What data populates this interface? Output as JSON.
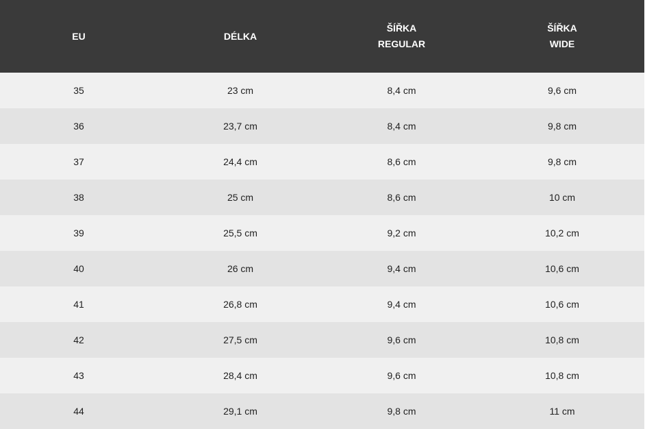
{
  "table": {
    "headers": [
      {
        "lines": [
          "EU"
        ]
      },
      {
        "lines": [
          "DÉLKA"
        ]
      },
      {
        "lines": [
          "ŠÍŘKA",
          "REGULAR"
        ]
      },
      {
        "lines": [
          "ŠÍŘKA",
          "WIDE"
        ]
      }
    ],
    "rows": [
      [
        "35",
        "23 cm",
        "8,4 cm",
        "9,6 cm"
      ],
      [
        "36",
        "23,7 cm",
        "8,4 cm",
        "9,8 cm"
      ],
      [
        "37",
        "24,4 cm",
        "8,6 cm",
        "9,8 cm"
      ],
      [
        "38",
        "25 cm",
        "8,6 cm",
        "10 cm"
      ],
      [
        "39",
        "25,5 cm",
        "9,2 cm",
        "10,2 cm"
      ],
      [
        "40",
        "26 cm",
        "9,4 cm",
        "10,6 cm"
      ],
      [
        "41",
        "26,8 cm",
        "9,4 cm",
        "10,6 cm"
      ],
      [
        "42",
        "27,5 cm",
        "9,6 cm",
        "10,8 cm"
      ],
      [
        "43",
        "28,4 cm",
        "9,6 cm",
        "10,8 cm"
      ],
      [
        "44",
        "29,1 cm",
        "9,8 cm",
        "11 cm"
      ]
    ]
  }
}
